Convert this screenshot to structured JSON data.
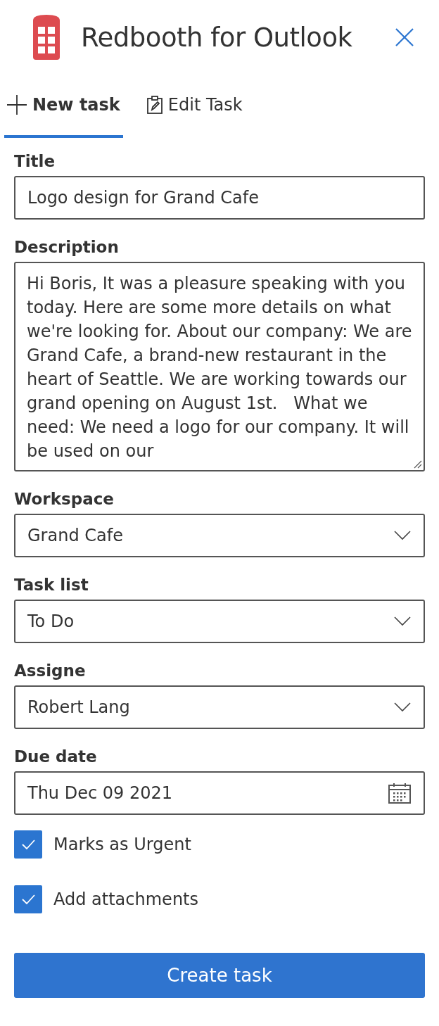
{
  "header": {
    "title": "Redbooth for Outlook"
  },
  "tabs": [
    {
      "label": "New task",
      "selected": true
    },
    {
      "label": "Edit Task",
      "selected": false
    }
  ],
  "fields": [
    {
      "kind": "text",
      "label": "Title",
      "value": "Logo design for Grand Cafe"
    },
    {
      "kind": "textarea",
      "label": "Description",
      "value": "Hi Boris, It was a pleasure speaking with you today. Here are some more details on what we're looking for. About our company: We are Grand Cafe, a brand-new restaurant in the heart of Seattle. We are working towards our grand opening on August 1st.   What we need: We need a logo for our company. It will be used on our"
    },
    {
      "kind": "select",
      "label": "Workspace",
      "value": "Grand Cafe"
    },
    {
      "kind": "select",
      "label": "Task list",
      "value": "To Do"
    },
    {
      "kind": "select",
      "label": "Assigne",
      "value": "Robert Lang"
    },
    {
      "kind": "date",
      "label": "Due date",
      "value": "Thu Dec 09 2021"
    }
  ],
  "checkboxes": [
    {
      "label": "Marks as Urgent",
      "checked": true
    },
    {
      "label": "Add attachments",
      "checked": true
    }
  ],
  "submit": {
    "label": "Create task"
  }
}
